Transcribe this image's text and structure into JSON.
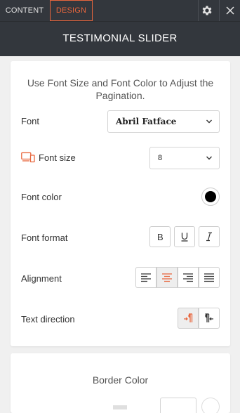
{
  "tabs": [
    {
      "label": "CONTENT",
      "active": false
    },
    {
      "label": "DESIGN",
      "active": true
    }
  ],
  "header": {
    "title": "TESTIMONIAL SLIDER"
  },
  "accent_color": "#e8663d",
  "panel": {
    "intro": "Use Font Size and Font Color to Adjust the Pagination.",
    "font": {
      "label": "Font",
      "value": "Abril Fatface"
    },
    "font_size": {
      "label": "Font size",
      "value": "8"
    },
    "font_color": {
      "label": "Font color",
      "value": "#000000"
    },
    "font_format": {
      "label": "Font format",
      "buttons": [
        "B",
        "U",
        "I"
      ]
    },
    "alignment": {
      "label": "Alignment",
      "options": [
        "left",
        "center",
        "right",
        "justify"
      ],
      "selected": "center"
    },
    "text_direction": {
      "label": "Text direction",
      "options": [
        "ltr",
        "rtl"
      ],
      "selected": "ltr"
    }
  },
  "border_section": {
    "title": "Border Color"
  }
}
